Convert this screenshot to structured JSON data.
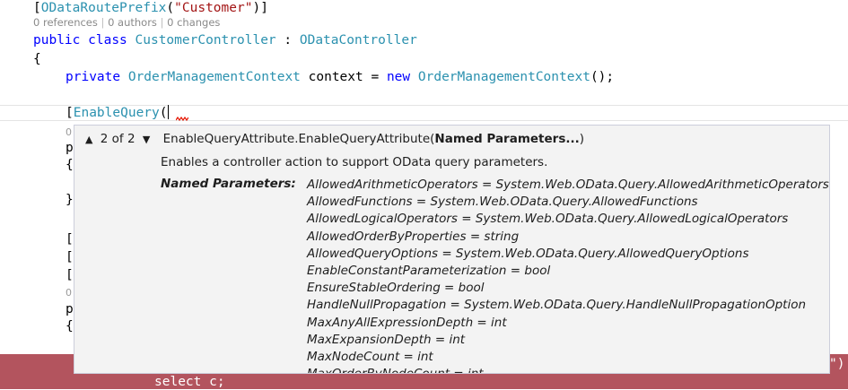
{
  "editor": {
    "line_route_prefix": {
      "open": "[",
      "attr": "ODataRoutePrefix",
      "paren_open": "(",
      "arg": "\"Customer\"",
      "close": ")]"
    },
    "codelens": {
      "references": "0 references",
      "sep": " | ",
      "authors": "0 authors",
      "changes": "0 changes"
    },
    "line_class": {
      "kw1": "public",
      "kw2": "class",
      "name": "CustomerController",
      "colon": " : ",
      "base": "ODataController"
    },
    "line_brace": "{",
    "line_context": {
      "kw_private": "private",
      "type": "OrderManagementContext",
      "field": " context = ",
      "kw_new": "new",
      "ctor": "OrderManagementContext",
      "tail": "();"
    },
    "line_enable": {
      "open": "[",
      "attr": "EnableQuery",
      "paren": "("
    },
    "fragments": {
      "zero": "0",
      "p": "p",
      "brace_open": "{",
      "brace_close": "}",
      "bracket": "["
    },
    "error_line": "select c;",
    "error_tail": "\")"
  },
  "tooltip": {
    "up_arrow": "▲",
    "counter": "2 of 2",
    "down_arrow": "▼",
    "signature_prefix": "EnableQueryAttribute.EnableQueryAttribute(",
    "signature_bold": "Named Parameters...",
    "signature_suffix": ")",
    "description": "Enables a controller action to support OData query parameters.",
    "named_parameters_label": "Named Parameters:",
    "parameters": [
      "AllowedArithmeticOperators = System.Web.OData.Query.AllowedArithmeticOperators",
      "AllowedFunctions = System.Web.OData.Query.AllowedFunctions",
      "AllowedLogicalOperators = System.Web.OData.Query.AllowedLogicalOperators",
      "AllowedOrderByProperties = string",
      "AllowedQueryOptions = System.Web.OData.Query.AllowedQueryOptions",
      "EnableConstantParameterization = bool",
      "EnsureStableOrdering = bool",
      "HandleNullPropagation = System.Web.OData.Query.HandleNullPropagationOption",
      "MaxAnyAllExpressionDepth = int",
      "MaxExpansionDepth = int",
      "MaxNodeCount = int",
      "MaxOrderByNodeCount = int"
    ]
  },
  "colors": {
    "keyword": "#0000ff",
    "type": "#2b91af",
    "string": "#a31515",
    "error_background": "#b3545e",
    "tooltip_background": "#f3f3f3"
  }
}
